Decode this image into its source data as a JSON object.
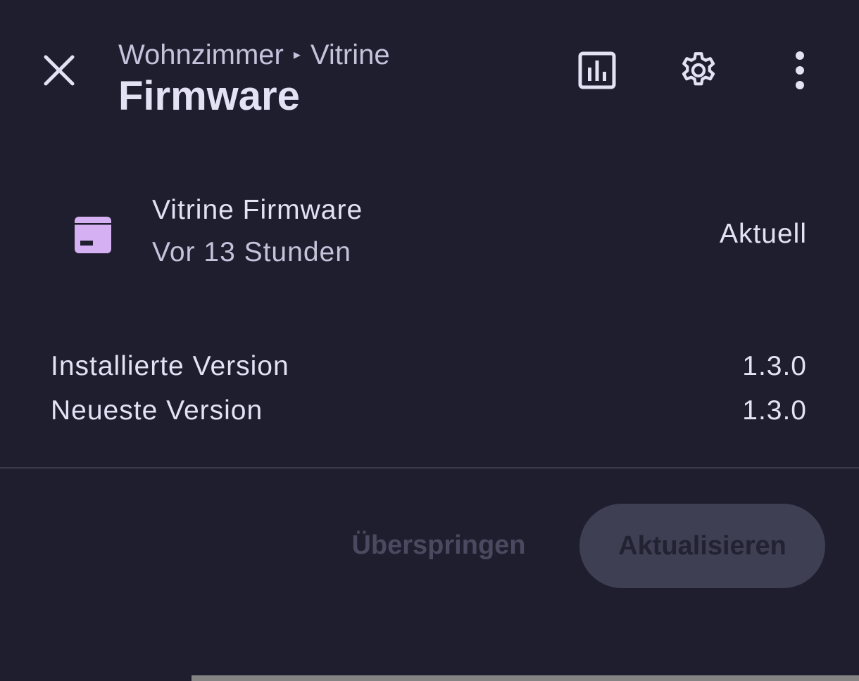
{
  "header": {
    "breadcrumb_area": "Wohnzimmer",
    "breadcrumb_separator": "▸",
    "breadcrumb_device": "Vitrine",
    "title": "Firmware"
  },
  "toolbar": {
    "icons": [
      "close-icon",
      "chart-icon",
      "gear-icon",
      "more-vertical-icon"
    ]
  },
  "firmware": {
    "icon": "package-icon",
    "icon_color": "#d5b0f2",
    "name": "Vitrine Firmware",
    "time": "Vor 13 Stunden",
    "status": "Aktuell"
  },
  "versions": [
    {
      "label": "Installierte Version",
      "value": "1.3.0"
    },
    {
      "label": "Neueste Version",
      "value": "1.3.0"
    }
  ],
  "actions": {
    "skip_label": "Überspringen",
    "update_label": "Aktualisieren"
  },
  "colors": {
    "background": "#1f1e2e",
    "text_primary": "#e4e1f5",
    "text_secondary": "#c5c2dc",
    "button_disabled_bg": "#3f3f53"
  }
}
